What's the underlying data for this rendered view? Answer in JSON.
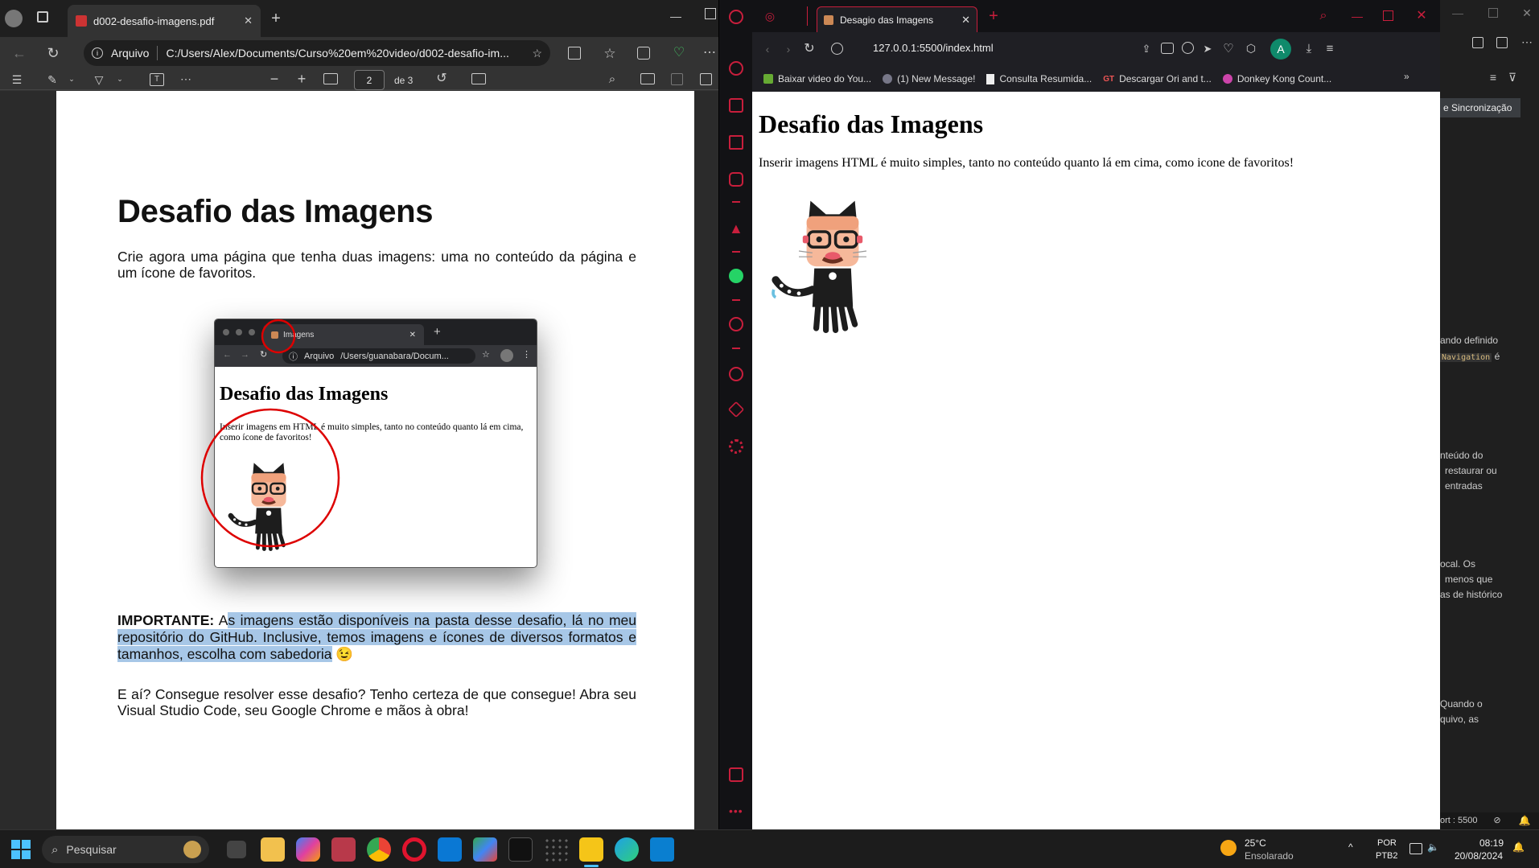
{
  "edge": {
    "tab_title": "d002-desafio-imagens.pdf",
    "addr_security_label": "Arquivo",
    "addr_url": "C:/Users/Alex/Documents/Curso%20em%20video/d002-desafio-im...",
    "pdf_page_current": "2",
    "pdf_page_total_label": "de 3"
  },
  "pdf": {
    "title": "Desafio das Imagens",
    "intro": "Crie agora uma página que tenha duas imagens: uma no conteúdo da página e um ícone de favoritos.",
    "important_label": "IMPORTANTE:",
    "important_first": "A",
    "important_text": "s imagens estão disponíveis na pasta desse desafio, lá no meu repositório do GitHub. Inclusive, temos imagens e ícones de diversos formatos e tamanhos, escolha com sabedoria",
    "important_emoji": "😉",
    "closing": "E aí? Consegue resolver esse desafio? Tenho certeza de que consegue! Abra seu Visual Studio Code, seu Google Chrome e mãos à obra!",
    "mini": {
      "tab_title": "Imagens",
      "security_label": "Arquivo",
      "url": "/Users/guanabara/Docum...",
      "heading": "Desafio das Imagens",
      "paragraph": "Inserir imagens em HTML é muito simples, tanto no conteúdo quanto lá em cima, como ícone de favoritos!"
    }
  },
  "opera": {
    "tab_title": "Desagio das Imagens",
    "url": "127.0.0.1:5500/index.html",
    "profile_initial": "A",
    "bookmarks": [
      {
        "label": "Baixar video do You...",
        "icon": "download-icon"
      },
      {
        "label": "(1) New Message!",
        "icon": "avatar-icon"
      },
      {
        "label": "Consulta Resumida...",
        "icon": "page-icon"
      },
      {
        "label": "Descargar Ori and t...",
        "icon": "gt-icon"
      },
      {
        "label": "Donkey Kong Count...",
        "icon": "game-icon"
      }
    ],
    "page": {
      "heading": "Desafio das Imagens",
      "paragraph": "Inserir imagens HTML é muito simples, tanto no conteúdo quanto lá em cima, como icone de favoritos!"
    }
  },
  "vscode": {
    "button": "e Sincronização",
    "line1": "ando definido",
    "line2a": "Navigation",
    "line2b": "é",
    "line3": "nteúdo do",
    "line4": "restaurar ou",
    "line5": "entradas",
    "line6": "ocal. Os",
    "line7": "menos que",
    "line8": "as de histórico",
    "line9": "Quando o",
    "line10": "quivo, as",
    "status_port": "ort : 5500"
  },
  "taskbar": {
    "search_placeholder": "Pesquisar",
    "weather_temp": "25°C",
    "weather_desc": "Ensolarado",
    "lang1": "POR",
    "lang2": "PTB2",
    "time": "08:19",
    "date": "20/08/2024"
  },
  "colors": {
    "opera_accent": "#c81e3c",
    "highlight": "#a7c7e7",
    "profile": "#0f8a6b"
  }
}
